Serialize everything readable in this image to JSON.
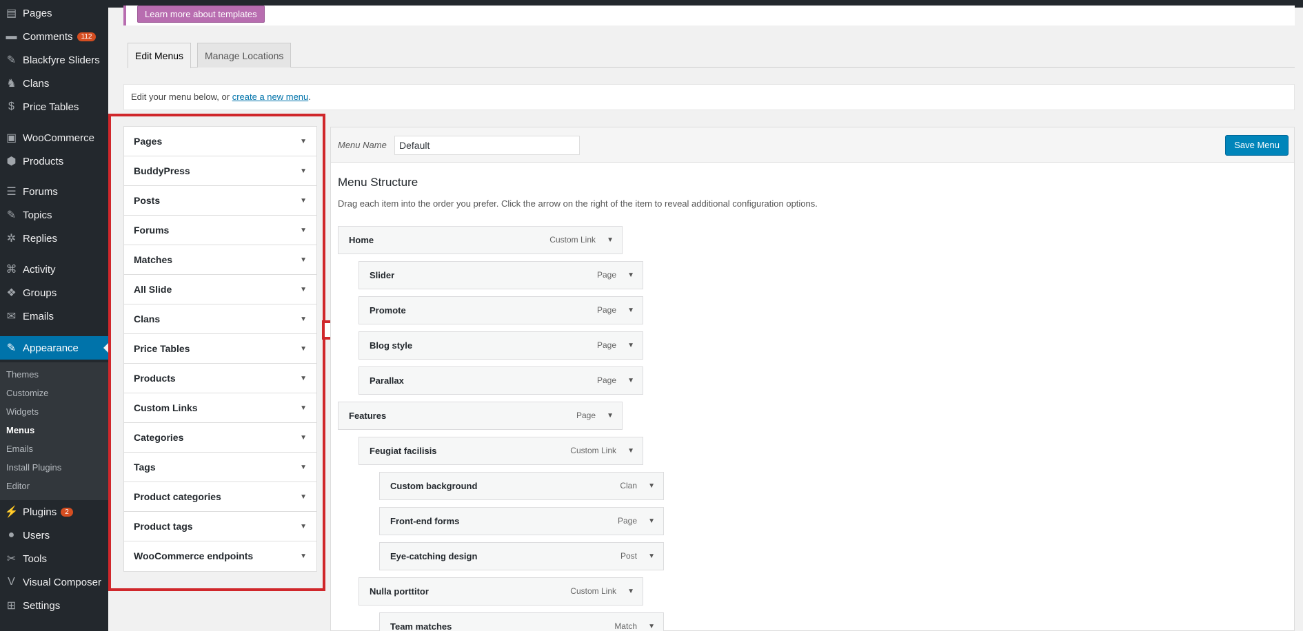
{
  "sidebar": {
    "items": [
      {
        "label": "Pages",
        "icon": "pages-icon",
        "glyph": "▤"
      },
      {
        "label": "Comments",
        "icon": "comments-icon",
        "glyph": "▬",
        "badge": "112"
      },
      {
        "label": "Blackfyre Sliders",
        "icon": "pin-icon",
        "glyph": "✎"
      },
      {
        "label": "Clans",
        "icon": "clan-icon",
        "glyph": "♞"
      },
      {
        "label": "Price Tables",
        "icon": "dollar-icon",
        "glyph": "$"
      },
      {
        "label": "WooCommerce",
        "icon": "woocommerce-icon",
        "glyph": "▣"
      },
      {
        "label": "Products",
        "icon": "box-icon",
        "glyph": "⬢"
      },
      {
        "label": "Forums",
        "icon": "forums-icon",
        "glyph": "☰"
      },
      {
        "label": "Topics",
        "icon": "topics-icon",
        "glyph": "✎"
      },
      {
        "label": "Replies",
        "icon": "replies-icon",
        "glyph": "✲"
      },
      {
        "label": "Activity",
        "icon": "activity-icon",
        "glyph": "⌘"
      },
      {
        "label": "Groups",
        "icon": "groups-icon",
        "glyph": "❖"
      },
      {
        "label": "Emails",
        "icon": "mail-icon",
        "glyph": "✉"
      },
      {
        "label": "Appearance",
        "icon": "brush-icon",
        "glyph": "✎"
      },
      {
        "label": "Plugins",
        "icon": "plugin-icon",
        "glyph": "⚡",
        "badge": "2"
      },
      {
        "label": "Users",
        "icon": "users-icon",
        "glyph": "●"
      },
      {
        "label": "Tools",
        "icon": "wrench-icon",
        "glyph": "✂"
      },
      {
        "label": "Visual Composer",
        "icon": "vc-icon",
        "glyph": "V"
      },
      {
        "label": "Settings",
        "icon": "settings-icon",
        "glyph": "⊞"
      }
    ],
    "submenu": [
      "Themes",
      "Customize",
      "Widgets",
      "Menus",
      "Emails",
      "Install Plugins",
      "Editor"
    ]
  },
  "notice": {
    "button": "Learn more about templates"
  },
  "tabs": {
    "edit": "Edit Menus",
    "manage": "Manage Locations"
  },
  "manage": {
    "text": "Edit your menu below, or ",
    "link": "create a new menu",
    "end": "."
  },
  "accordion": [
    "Pages",
    "BuddyPress",
    "Posts",
    "Forums",
    "Matches",
    "All Slide",
    "Clans",
    "Price Tables",
    "Products",
    "Custom Links",
    "Categories",
    "Tags",
    "Product categories",
    "Product tags",
    "WooCommerce endpoints"
  ],
  "menu": {
    "name_label": "Menu Name",
    "name_value": "Default",
    "save": "Save Menu",
    "structure_title": "Menu Structure",
    "structure_desc": "Drag each item into the order you prefer. Click the arrow on the right of the item to reveal additional configuration options.",
    "items": [
      {
        "title": "Home",
        "type": "Custom Link",
        "depth": 0
      },
      {
        "title": "Slider",
        "type": "Page",
        "depth": 1
      },
      {
        "title": "Promote",
        "type": "Page",
        "depth": 1
      },
      {
        "title": "Blog style",
        "type": "Page",
        "depth": 1
      },
      {
        "title": "Parallax",
        "type": "Page",
        "depth": 1
      },
      {
        "title": "Features",
        "type": "Page",
        "depth": 0
      },
      {
        "title": "Feugiat facilisis",
        "type": "Custom Link",
        "depth": 1
      },
      {
        "title": "Custom background",
        "type": "Clan",
        "depth": 2
      },
      {
        "title": "Front-end forms",
        "type": "Page",
        "depth": 2
      },
      {
        "title": "Eye-catching design",
        "type": "Post",
        "depth": 2
      },
      {
        "title": "Nulla porttitor",
        "type": "Custom Link",
        "depth": 1
      },
      {
        "title": "Team matches",
        "type": "Match",
        "depth": 2
      }
    ]
  }
}
